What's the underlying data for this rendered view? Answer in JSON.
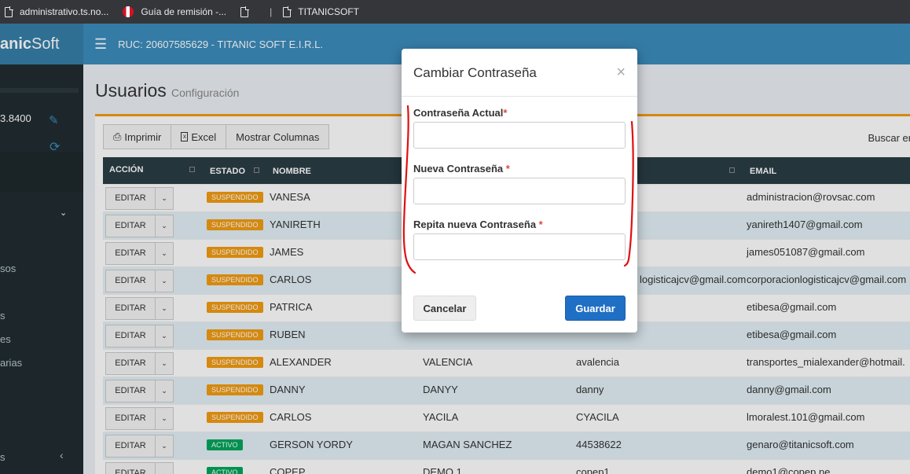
{
  "bookmarks": [
    {
      "label": "administrativo.ts.no...",
      "icon": "page-icon"
    },
    {
      "label": "Guía de remisión -...",
      "icon": "peru-flag-icon"
    },
    {
      "label": "",
      "icon": "page-icon"
    },
    {
      "label": "|",
      "icon": ""
    },
    {
      "label": "TITANICSOFT",
      "icon": "page-icon"
    }
  ],
  "brand": {
    "part1": "anic",
    "part2": "Soft"
  },
  "header": {
    "ruc": "RUC: 20607585629 - TITANIC SOFT E.I.R.L."
  },
  "sidebar": {
    "balance": "3.8400",
    "items": [
      "sos",
      "s",
      "es",
      "arias",
      "s"
    ]
  },
  "page": {
    "title": "Usuarios",
    "subtitle": "Configuración"
  },
  "toolbar": {
    "print": "Imprimir",
    "excel": "Excel",
    "columns": "Mostrar Columnas",
    "search_label": "Buscar en"
  },
  "table": {
    "headers": {
      "action": "ACCIÓN",
      "status": "ESTADO",
      "name": "NOMBRE",
      "email": "EMAIL"
    },
    "edit_label": "EDITAR",
    "rows": [
      {
        "status": "SUSPENDIDO",
        "name": "VANESA",
        "last": "",
        "user": "",
        "email": "administracion@rovsac.com"
      },
      {
        "status": "SUSPENDIDO",
        "name": "YANIRETH",
        "last": "",
        "user": "",
        "email": "yanireth1407@gmail.com"
      },
      {
        "status": "SUSPENDIDO",
        "name": "JAMES",
        "last": "",
        "user": "",
        "email": "james051087@gmail.com"
      },
      {
        "status": "SUSPENDIDO",
        "name": "CARLOS",
        "last": "",
        "user": "logisticajcv@gmail.com",
        "email": "corporacionlogisticajcv@gmail.com"
      },
      {
        "status": "SUSPENDIDO",
        "name": "PATRICA",
        "last": "",
        "user": "",
        "email": "etibesa@gmail.com"
      },
      {
        "status": "SUSPENDIDO",
        "name": "RUBEN",
        "last": "",
        "user": "",
        "email": "etibesa@gmail.com"
      },
      {
        "status": "SUSPENDIDO",
        "name": "ALEXANDER",
        "last": "VALENCIA",
        "user": "avalencia",
        "email": "transportes_mialexander@hotmail."
      },
      {
        "status": "SUSPENDIDO",
        "name": "DANNY",
        "last": "DANYY",
        "user": "danny",
        "email": "danny@gmail.com"
      },
      {
        "status": "SUSPENDIDO",
        "name": "CARLOS",
        "last": "YACILA",
        "user": "CYACILA",
        "email": "lmoralest.101@gmail.com"
      },
      {
        "status": "ACTIVO",
        "name": "GERSON YORDY",
        "last": "MAGAN SANCHEZ",
        "user": "44538622",
        "email": "genaro@titanicsoft.com"
      },
      {
        "status": "ACTIVO",
        "name": "COPEP",
        "last": "DEMO 1",
        "user": "copep1",
        "email": "demo1@copep.pe"
      }
    ]
  },
  "modal": {
    "title": "Cambiar Contraseña",
    "close": "×",
    "current_label": "Contraseña Actual",
    "new_label": "Nueva Contraseña ",
    "repeat_label": "Repita nueva Contraseña ",
    "required_mark": "*",
    "cancel": "Cancelar",
    "save": "Guardar"
  },
  "colors": {
    "header": "#3c8dbc",
    "sidebar": "#222d32",
    "table_header": "#2a3d45",
    "suspended": "#f39c12",
    "active": "#00a65a",
    "primary_button": "#1f6fc5",
    "annotation": "#e01010"
  }
}
